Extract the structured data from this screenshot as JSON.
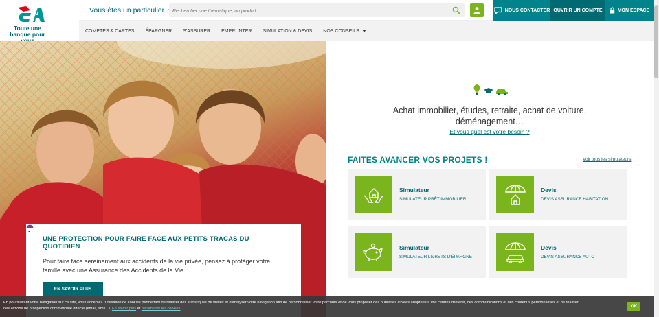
{
  "brand": {
    "tagline": "Toute une banque pour vous",
    "accent": "#006a72",
    "green": "#7ab51d"
  },
  "header": {
    "visitor_label": "Vous êtes un particulier",
    "search_placeholder": "Rechercher une thématique, un produit...",
    "contact_label": "NOUS CONTACTER",
    "open_account_label": "OUVRIR UN COMPTE",
    "my_space_label": "MON ESPACE"
  },
  "nav": {
    "items": [
      "COMPTES & CARTES",
      "ÉPARGNER",
      "S'ASSURER",
      "EMPRUNTER",
      "SIMULATION & DEVIS",
      "NOS CONSEILS"
    ]
  },
  "hero": {
    "card_title": "UNE PROTECTION POUR FAIRE FACE AUX PETITS TRACAS DU QUOTIDIEN",
    "card_text": "Pour faire face sereinement aux accidents de la vie privée, pensez à protéger votre famille avec une Assurance des Accidents de la Vie",
    "cta_label": "EN SAVOIR PLUS"
  },
  "needs": {
    "headline": "Achat immobilier, études, retraite, achat de voiture, déménagement…",
    "link": "Et vous quel est votre besoin ?"
  },
  "projects": {
    "title": "FAITES AVANCER VOS PROJETS !",
    "all_link": "Voir tous les simulateurs",
    "tiles": [
      {
        "kind": "Simulateur",
        "label": "SIMULATEUR PRÊT IMMOBILIER",
        "icon": "house-hands-icon"
      },
      {
        "kind": "Devis",
        "label": "DEVIS ASSURANCE HABITATION",
        "icon": "umbrella-house-icon"
      },
      {
        "kind": "Simulateur",
        "label": "SIMULATEUR LIVRETS D'ÉPARGNE",
        "icon": "piggy-bank-icon"
      },
      {
        "kind": "Devis",
        "label": "DEVIS ASSURANCE AUTO",
        "icon": "umbrella-car-icon"
      }
    ]
  },
  "cookie": {
    "text": "En poursuivant votre navigation sur ce site, vous acceptez l'utilisation de cookies permettant de réaliser des statistiques de visites et d'analyser votre navigation afin de personnaliser votre parcours et de vous proposer des publicités ciblées adaptées à vos centres d'intérêt, des communications et des contenus personnalisés et de réaliser des actions de prospection commerciale directe (email, sms...).",
    "link1": "En savoir plus",
    "and": "et",
    "link2": "paramétrer les cookies",
    "ok_label": "OK"
  }
}
